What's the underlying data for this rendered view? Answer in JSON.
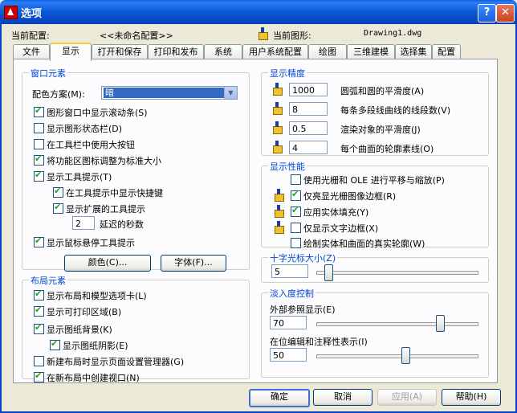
{
  "window": {
    "title": "选项",
    "help_glyph": "?",
    "close_glyph": "✕"
  },
  "header": {
    "config_label": "当前配置:",
    "config_value": "<<未命名配置>>",
    "drawing_label": "当前图形:",
    "drawing_value": "Drawing1.dwg"
  },
  "tabs": [
    "文件",
    "显示",
    "打开和保存",
    "打印和发布",
    "系统",
    "用户系统配置",
    "绘图",
    "三维建模",
    "选择集",
    "配置"
  ],
  "window_elements": {
    "title": "窗口元素",
    "color_scheme_label": "配色方案(M):",
    "color_scheme_value": "暗",
    "opts": [
      {
        "label": "图形窗口中显示滚动条(S)",
        "checked": true
      },
      {
        "label": "显示图形状态栏(D)",
        "checked": false
      },
      {
        "label": "在工具栏中使用大按钮",
        "checked": false
      },
      {
        "label": "将功能区图标调整为标准大小",
        "checked": true
      },
      {
        "label": "显示工具提示(T)",
        "checked": true
      },
      {
        "label": "在工具提示中显示快捷键",
        "checked": true
      },
      {
        "label": "显示扩展的工具提示",
        "checked": true
      },
      {
        "label": "显示鼠标悬停工具提示",
        "checked": true
      }
    ],
    "delay_value": "2",
    "delay_label": "延迟的秒数",
    "color_btn": "颜色(C)...",
    "font_btn": "字体(F)..."
  },
  "layout_elements": {
    "title": "布局元素",
    "opts": [
      {
        "label": "显示布局和模型选项卡(L)",
        "checked": true
      },
      {
        "label": "显示可打印区域(B)",
        "checked": true
      },
      {
        "label": "显示图纸背景(K)",
        "checked": true
      },
      {
        "label": "显示图纸阴影(E)",
        "checked": true
      },
      {
        "label": "新建布局时显示页面设置管理器(G)",
        "checked": false
      },
      {
        "label": "在新布局中创建视口(N)",
        "checked": true
      }
    ]
  },
  "display_resolution": {
    "title": "显示精度",
    "rows": [
      {
        "value": "1000",
        "label": "圆弧和圆的平滑度(A)"
      },
      {
        "value": "8",
        "label": "每条多段线曲线的线段数(V)"
      },
      {
        "value": "0.5",
        "label": "渲染对象的平滑度(J)"
      },
      {
        "value": "4",
        "label": "每个曲面的轮廓素线(O)"
      }
    ]
  },
  "display_performance": {
    "title": "显示性能",
    "opts": [
      {
        "label": "使用光栅和 OLE 进行平移与缩放(P)",
        "checked": false
      },
      {
        "label": "仅亮显光栅图像边框(R)",
        "checked": true
      },
      {
        "label": "应用实体填充(Y)",
        "checked": true
      },
      {
        "label": "仅显示文字边框(X)",
        "checked": false
      },
      {
        "label": "绘制实体和曲面的真实轮廓(W)",
        "checked": false
      }
    ]
  },
  "crosshair": {
    "title": "十字光标大小(Z)",
    "value": "5",
    "level": 5
  },
  "fade": {
    "title": "淡入度控制",
    "xref_label": "外部参照显示(E)",
    "xref_value": "70",
    "xref_level": 70,
    "inplace_label": "在位编辑和注释性表示(I)",
    "inplace_value": "50",
    "inplace_level": 50
  },
  "footer": {
    "ok": "确定",
    "cancel": "取消",
    "apply": "应用(A)",
    "help": "帮助(H)"
  }
}
